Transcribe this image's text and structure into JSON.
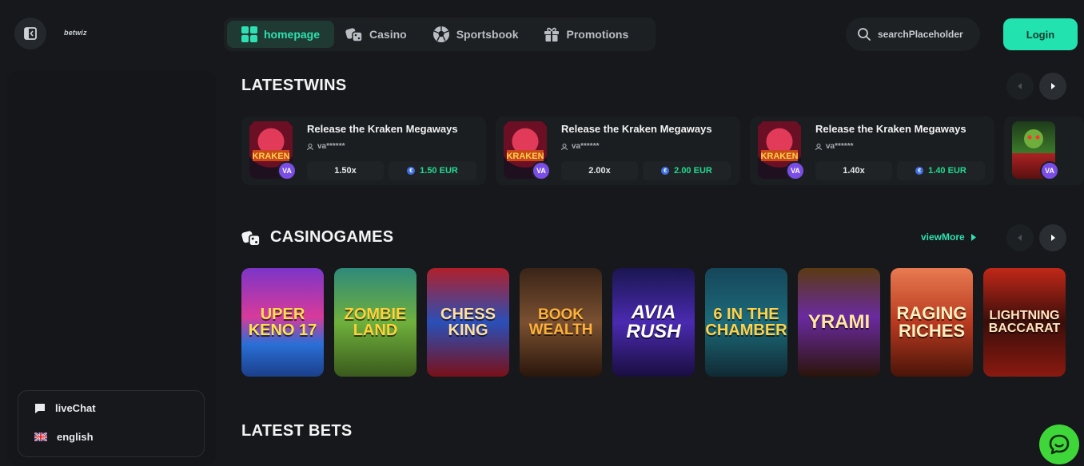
{
  "header": {
    "logo_text": "betwiz",
    "nav": [
      {
        "label": "homepage",
        "icon": "grid-icon",
        "active": true
      },
      {
        "label": "Casino",
        "icon": "casino-dice-icon",
        "active": false
      },
      {
        "label": "Sportsbook",
        "icon": "soccer-ball-icon",
        "active": false
      },
      {
        "label": "Promotions",
        "icon": "gift-icon",
        "active": false
      }
    ],
    "search_placeholder": "searchPlaceholder",
    "login_label": "Login"
  },
  "sidebar": {
    "live_chat_label": "liveChat",
    "language_label": "english"
  },
  "latest_wins": {
    "title": "LATESTWINS",
    "items": [
      {
        "game": "Release the Kraken Megaways",
        "user": "va******",
        "badge": "VA",
        "multiplier": "1.50x",
        "amount": "1.50 EUR"
      },
      {
        "game": "Release the Kraken Megaways",
        "user": "va******",
        "badge": "VA",
        "multiplier": "2.00x",
        "amount": "2.00 EUR"
      },
      {
        "game": "Release the Kraken Megaways",
        "user": "va******",
        "badge": "VA",
        "multiplier": "1.40x",
        "amount": "1.40 EUR"
      },
      {
        "game": "",
        "user": "",
        "badge": "VA",
        "multiplier": "",
        "amount": ""
      }
    ]
  },
  "casino_games": {
    "title": "CASINOGAMES",
    "view_more_label": "viewMore",
    "games": [
      {
        "art_text": "UPER KENO 17"
      },
      {
        "art_text": "ZOMBIE LAND"
      },
      {
        "art_text": "CHESS KING"
      },
      {
        "art_text": "BOOK WEALTH"
      },
      {
        "art_text": "AVIA RUSH"
      },
      {
        "art_text": "6 IN THE CHAMBER"
      },
      {
        "art_text": "YRAMI"
      },
      {
        "art_text": "RAGING RICHES"
      },
      {
        "art_text": "LIGHTNING BACCARAT"
      }
    ]
  },
  "latest_bets": {
    "title": "LATEST BETS"
  },
  "colors": {
    "accent": "#22e2b0",
    "win_green": "#22d98f",
    "badge_purple": "#7a4ee6",
    "chat_green": "#3fd63a"
  }
}
